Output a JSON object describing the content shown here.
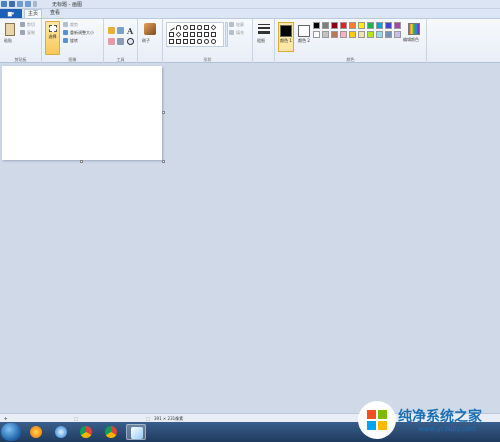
{
  "window": {
    "title": "无标题 - 画图"
  },
  "tabs": {
    "file": "▆▾",
    "home": "主页",
    "view": "查看"
  },
  "clipboard": {
    "paste": "粘贴",
    "cut": "剪切",
    "copy": "复制",
    "group": "剪贴板"
  },
  "image": {
    "select": "选择",
    "crop": "裁剪",
    "resize": "重新调整大小",
    "rotate": "旋转",
    "group": "图像"
  },
  "tools": {
    "group": "工具",
    "text_tool": "A"
  },
  "brushes": {
    "label": "刷子"
  },
  "shapes": {
    "outline": "轮廓",
    "fill": "填充",
    "group": "形状"
  },
  "size": {
    "label": "粗细"
  },
  "colors": {
    "color1_label": "颜色 1",
    "color2_label": "颜色 2",
    "edit_label": "编辑颜色",
    "group": "颜色",
    "color1": "#000000",
    "color2": "#ffffff",
    "palette": [
      "#000000",
      "#7f7f7f",
      "#880015",
      "#ed1c24",
      "#ff7f27",
      "#fff200",
      "#22b14c",
      "#00a2e8",
      "#3f48cc",
      "#a349a4",
      "#ffffff",
      "#c3c3c3",
      "#b97a57",
      "#ffaec9",
      "#ffc90e",
      "#efe4b0",
      "#b5e61d",
      "#99d9ea",
      "#7092be",
      "#c8bfe7"
    ]
  },
  "status": {
    "size": "391 × 231像素"
  },
  "watermark": {
    "text": "纯净系统之家",
    "url": "www.ycwjzy.com"
  }
}
